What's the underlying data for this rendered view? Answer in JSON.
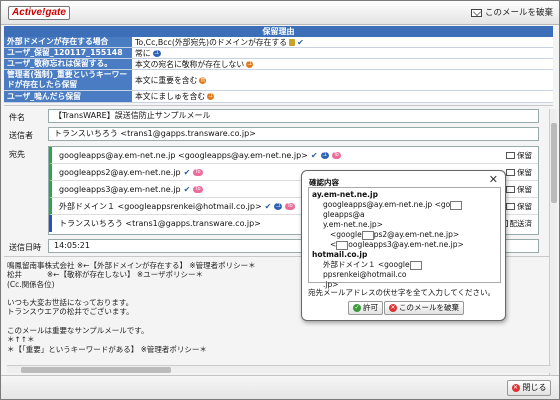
{
  "app": {
    "logo": "Active!gate",
    "discard_mail_label": "このメールを破棄"
  },
  "reasons": {
    "header": "保留理由",
    "rows": [
      {
        "key": "外部ドメインが存在する場合",
        "value": "To,Cc,Bcc(外部宛先)のドメインが存在する"
      },
      {
        "key": "ユーザ_保留_120117_155148",
        "value": "常に"
      },
      {
        "key": "ユーザ_敬称忘れは保留する。",
        "value": "本文の宛名に敬称が存在しない"
      },
      {
        "key": "管理者(強制)_重要というキーワードが存在したら保留",
        "value": "本文に重要を含む"
      },
      {
        "key": "ユーザ_嗚んだら保留",
        "value": "本文にましゅを含む"
      }
    ]
  },
  "mail": {
    "subject_label": "件名",
    "subject": "【TransWARE】誤送信防止サンプルメール",
    "from_label": "送信者",
    "from": "トランスいちろう <trans1@gapps.transware.co.jp>",
    "to_label": "宛先",
    "date_label": "送信日時",
    "date": "14:05:21",
    "recipients": [
      {
        "address": "googleapps@ay.em-net.ne.jp <googleapps@ay.em-net.ne.jp>",
        "action": "保留"
      },
      {
        "address": "googleapps2@ay.em-net.ne.jp",
        "action": "保留"
      },
      {
        "address": "googleapps3@ay.em-net.ne.jp",
        "action": "保留"
      },
      {
        "address": "外部ドメイン１ <googleappsrenkei@hotmail.co.jp>",
        "action": "保留"
      },
      {
        "address": "トランスいちろう <trans1@gapps.transware.co.jp>",
        "action": "配送済"
      }
    ],
    "to_badge": "To",
    "body": "鳴鳳留南事株式会社 ※←【外部ドメインが存在する】 ※管理者ポリシー＊\n松井　　　 ※←【敬称が存在しない】 ※ユーザポリシー＊\n(Cc.関係各位)\n\nいつも大変お世話になっております。\nトランスウエアの松井でございます。\n\nこのメールは重要なサンプルメールです。\n＊↑↑＊\n＊【「重要」というキーワードがある】 ※管理者ポリシー＊"
  },
  "popup": {
    "title": "確認内容",
    "close": "✕",
    "domain1": "ay.em-net.ne.jp",
    "line1": "googleapps@ay.em-net.ne.jp <go",
    "line1b": "gleapps@a",
    "line1c": "y.em-net.ne.jp>",
    "line2a": "<google",
    "line2b": "ps2@ay.em-net.ne.jp>",
    "line3a": "<",
    "line3b": "oogleapps3@ay.em-net.ne.jp>",
    "domain2": "hotmail.co.jp",
    "line4a": "外部ドメイン１ <google",
    "line4b": "ppsrenkei@hotmail.co",
    "line4c": ".jp>",
    "note": "宛先メールアドレスの伏せ字を全て入力してください。",
    "allow_label": "許可",
    "discard_label": "このメールを破棄"
  },
  "footer": {
    "close_label": "閉じる"
  },
  "colors": {
    "header_blue": "#3c6fb8",
    "label_blue": "#4a7cc3",
    "to_green": "#2aa54a",
    "sender_blue": "#2d4fc5",
    "to_pink": "#ec6d9a"
  }
}
